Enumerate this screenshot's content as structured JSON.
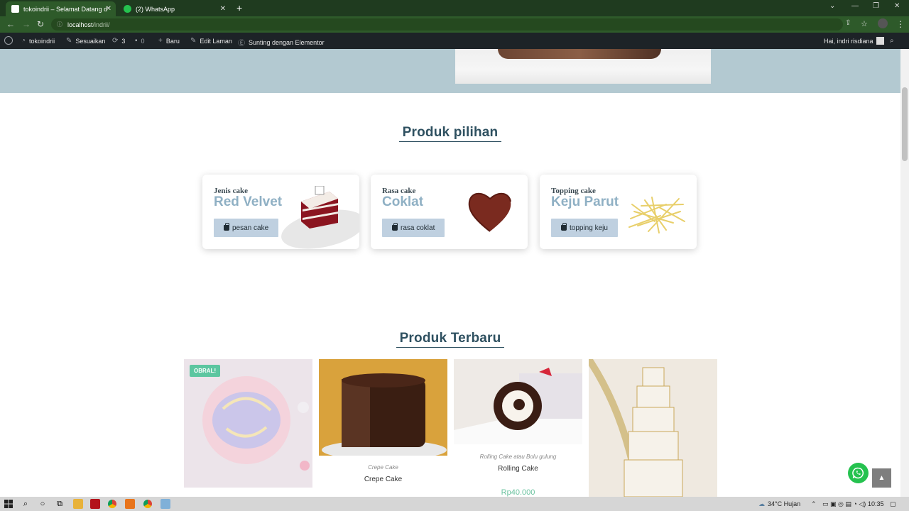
{
  "browser": {
    "tabs": [
      {
        "title": "tokoindrii – Selamat Datang di to",
        "active": true
      },
      {
        "title": "(2) WhatsApp",
        "active": false
      }
    ],
    "url_host": "localhost",
    "url_path": "/indrii/"
  },
  "adminbar": {
    "site": "tokoindrii",
    "customize": "Sesuaikan",
    "updates": "3",
    "comments": "0",
    "new": "Baru",
    "edit": "Edit Laman",
    "elementor": "Sunting dengan Elementor",
    "greeting": "Hai, indri risdiana"
  },
  "featured": {
    "title": "Produk pilihan",
    "cards": [
      {
        "kicker": "Jenis cake",
        "name": "Red Velvet",
        "button": "pesan cake"
      },
      {
        "kicker": "Rasa cake",
        "name": "Coklat",
        "button": "rasa coklat"
      },
      {
        "kicker": "Topping cake",
        "name": "Keju Parut",
        "button": "topping keju"
      }
    ]
  },
  "latest": {
    "title": "Produk Terbaru",
    "products": [
      {
        "badge": "OBRAL!",
        "category": "",
        "name": "",
        "price": ""
      },
      {
        "badge": "",
        "category": "Crepe Cake",
        "name": "Crepe Cake",
        "price": ""
      },
      {
        "badge": "",
        "category": "Rolling Cake atau Bolu gulung",
        "name": "Rolling Cake",
        "price": "Rp40.000"
      },
      {
        "badge": "",
        "category": "",
        "name": "",
        "price": ""
      }
    ]
  },
  "taskbar": {
    "weather": "34°C  Hujan",
    "time": "10:35"
  },
  "colors": {
    "accent": "#8fb0c4",
    "button_bg": "#bfd0e0",
    "heading": "#2e5060",
    "badge": "#5cc6a0",
    "whatsapp": "#25c24f"
  }
}
